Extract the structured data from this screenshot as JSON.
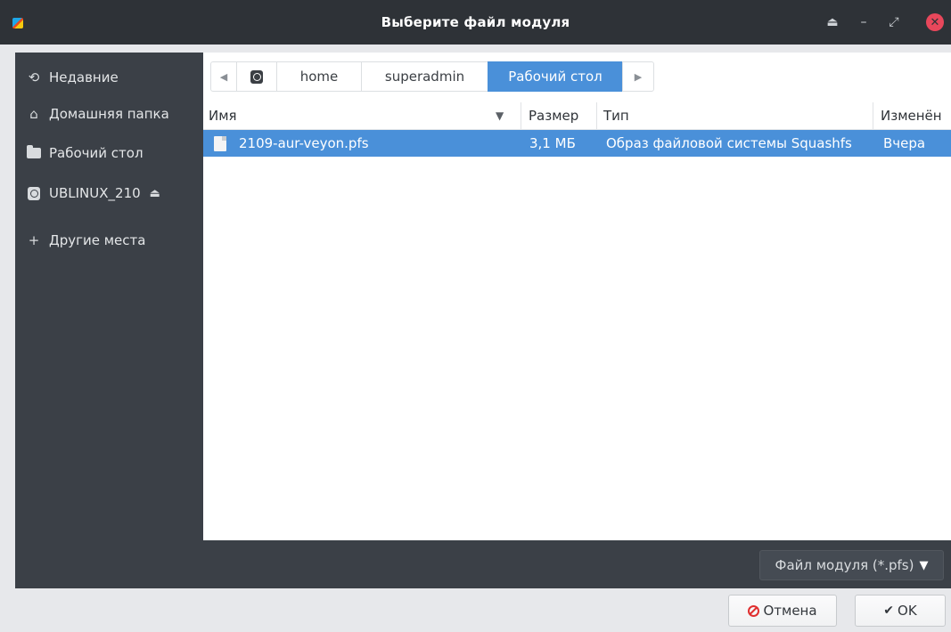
{
  "window": {
    "title": "Выберите файл модуля"
  },
  "sidebar": {
    "items": [
      {
        "label": "Недавние",
        "icon": "recent-icon"
      },
      {
        "label": "Домашняя папка",
        "icon": "home-icon"
      },
      {
        "label": "Рабочий стол",
        "icon": "folder-icon"
      },
      {
        "label": "UBLINUX_210",
        "icon": "drive-icon"
      },
      {
        "label": "Другие места",
        "icon": "plus-icon"
      }
    ]
  },
  "pathbar": {
    "segments": [
      "home",
      "superadmin",
      "Рабочий стол"
    ]
  },
  "columns": {
    "name": "Имя",
    "size": "Размер",
    "type": "Тип",
    "modified": "Изменён"
  },
  "files": [
    {
      "name": "2109-aur-veyon.pfs",
      "size": "3,1 МБ",
      "type": "Образ файловой системы Squashfs",
      "modified": "Вчера",
      "selected": true
    }
  ],
  "filter": {
    "label": "Файл модуля (*.pfs)"
  },
  "buttons": {
    "cancel": "Отмена",
    "ok": "OK"
  },
  "colors": {
    "accent": "#4a90d9",
    "sidebar_bg": "#3b4047",
    "titlebar_bg": "#2e3237",
    "close": "#e8475b"
  }
}
